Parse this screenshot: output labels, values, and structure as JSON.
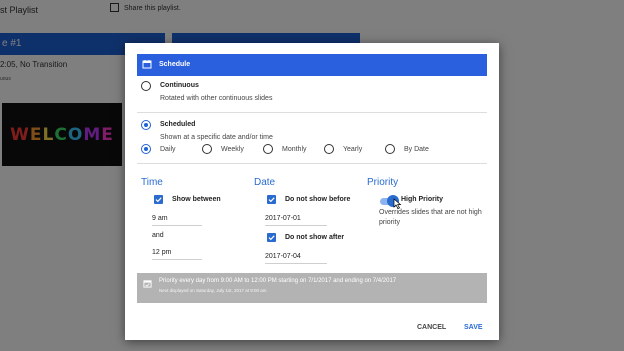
{
  "background": {
    "playlist_title": "st Playlist",
    "share_label": "Share this playlist.",
    "slide_card_label": "e #1",
    "transition_text": "2:05, No Transition",
    "small_text": "uous",
    "welcome_letters": [
      "W",
      "E",
      "L",
      "C",
      "O",
      "M",
      "E"
    ],
    "welcome_colors": [
      "#ff3b3b",
      "#ff9a2e",
      "#ffe14a",
      "#3be36b",
      "#3bc9ff",
      "#c03bff",
      "#ff3bd1"
    ]
  },
  "dialog": {
    "header": "Schedule",
    "continuous": {
      "label": "Continuous",
      "description": "Rotated with other continuous slides",
      "selected": false
    },
    "scheduled": {
      "label": "Scheduled",
      "description": "Shown at a specific date and/or time",
      "selected": true
    },
    "frequency": [
      {
        "label": "Daily",
        "selected": true
      },
      {
        "label": "Weekly",
        "selected": false
      },
      {
        "label": "Monthly",
        "selected": false
      },
      {
        "label": "Yearly",
        "selected": false
      },
      {
        "label": "By Date",
        "selected": false
      }
    ],
    "time": {
      "title": "Time",
      "show_between_label": "Show between",
      "show_between_checked": true,
      "start": "9 am",
      "and_label": "and",
      "end": "12 pm"
    },
    "date": {
      "title": "Date",
      "not_before_label": "Do not show before",
      "not_before_checked": true,
      "not_before_value": "2017-07-01",
      "not_after_label": "Do not show after",
      "not_after_checked": true,
      "not_after_value": "2017-07-04"
    },
    "priority": {
      "title": "Priority",
      "high_priority_label": "High Priority",
      "high_priority_on": true,
      "description_line1": "Overrides slides that are not high",
      "description_line2": "priority"
    },
    "summary": {
      "line1": "Priority every day from 9:00 AM to 12:00 PM starting on 7/1/2017 and ending on 7/4/2017",
      "line2": "Next displayed on Saturday, July 1st, 2017 at 9:00 am"
    },
    "buttons": {
      "cancel": "CANCEL",
      "save": "SAVE"
    },
    "colors": {
      "accent": "#2a6bd0",
      "header": "#2a5fde",
      "summary_bg": "#b3b3b3"
    }
  }
}
